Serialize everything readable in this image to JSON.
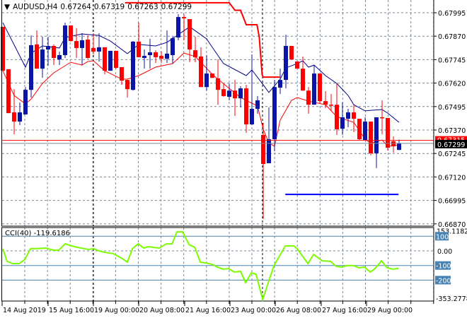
{
  "header": {
    "menu_icon": "triangle-down-icon",
    "symbol": "AUDUSD,H4",
    "open": "0.67264",
    "high": "0.67319",
    "low": "0.67263",
    "close": "0.67299"
  },
  "colors": {
    "bull": "#0a14a8",
    "bear": "#ff0000",
    "ma_fast": "#ff0000",
    "ma_slow": "#00008b",
    "step_line": "#ff0000",
    "support_line": "#0000ff",
    "cci": "#7cfc00",
    "cci_level": "#4682b4",
    "grid": "#778899"
  },
  "price_axis": {
    "labels": [
      "0.67995",
      "0.67870",
      "0.67745",
      "0.67620",
      "0.67495",
      "0.67370",
      "0.67245",
      "0.67120",
      "0.66995",
      "0.66870"
    ],
    "ask_label": "0.67315",
    "bid_label": "0.67299"
  },
  "time_axis": {
    "labels": [
      "14 Aug 2019",
      "15 Aug 16:00",
      "19 Aug 00:00",
      "20 Aug 08:00",
      "21 Aug 16:00",
      "23 Aug 00:00",
      "26 Aug 08:00",
      "27 Aug 16:00",
      "29 Aug 00:00"
    ]
  },
  "cci": {
    "title": "CCI(40) -119.6186",
    "axis_labels": {
      "max": "153.1182",
      "l100": "100",
      "l0": "0.00",
      "lm100": "-100",
      "lm200": "-200",
      "min": "-353.2778"
    }
  },
  "chart_data": {
    "type": "candlestick",
    "symbol": "AUDUSD",
    "timeframe": "H4",
    "ylim": [
      0.6687,
      0.68048
    ],
    "candles": [
      [
        0.6792,
        0.6792,
        0.67686,
        0.67686
      ],
      [
        0.67694,
        0.67694,
        0.6746,
        0.6746
      ],
      [
        0.67464,
        0.67588,
        0.67347,
        0.67415
      ],
      [
        0.67415,
        0.67517,
        0.67396,
        0.67464
      ],
      [
        0.67453,
        0.67599,
        0.67453,
        0.67584
      ],
      [
        0.67584,
        0.67874,
        0.67543,
        0.67822
      ],
      [
        0.67826,
        0.67901,
        0.67697,
        0.67697
      ],
      [
        0.67697,
        0.67867,
        0.67648,
        0.67799
      ],
      [
        0.67799,
        0.67867,
        0.67712,
        0.67818
      ],
      [
        0.67818,
        0.67826,
        0.67716,
        0.67754
      ],
      [
        0.67746,
        0.67788,
        0.67716,
        0.67769
      ],
      [
        0.67769,
        0.67942,
        0.67754,
        0.67927
      ],
      [
        0.67927,
        0.67927,
        0.67841,
        0.67844
      ],
      [
        0.67844,
        0.67912,
        0.67754,
        0.67807
      ],
      [
        0.67807,
        0.67886,
        0.67716,
        0.67848
      ],
      [
        0.67852,
        0.67874,
        0.6775,
        0.67754
      ],
      [
        0.67807,
        0.67886,
        0.67773,
        0.67788
      ],
      [
        0.67788,
        0.67886,
        0.67735,
        0.67811
      ],
      [
        0.67811,
        0.67811,
        0.67667,
        0.67686
      ],
      [
        0.67686,
        0.67792,
        0.67686,
        0.67792
      ],
      [
        0.67792,
        0.67792,
        0.67697,
        0.67701
      ],
      [
        0.67705,
        0.67705,
        0.67611,
        0.67633
      ],
      [
        0.67637,
        0.67637,
        0.67543,
        0.67588
      ],
      [
        0.67584,
        0.67844,
        0.6758,
        0.67841
      ],
      [
        0.67841,
        0.67942,
        0.67758,
        0.67758
      ],
      [
        0.67754,
        0.67799,
        0.67697,
        0.67765
      ],
      [
        0.67769,
        0.67856,
        0.67697,
        0.67784
      ],
      [
        0.67784,
        0.67795,
        0.67727,
        0.67758
      ],
      [
        0.67765,
        0.67788,
        0.67727,
        0.6775
      ],
      [
        0.6775,
        0.67901,
        0.67727,
        0.67777
      ],
      [
        0.67769,
        0.67867,
        0.67724,
        0.67859
      ],
      [
        0.67863,
        0.67988,
        0.67848,
        0.67972
      ],
      [
        0.67972,
        0.67988,
        0.67848,
        0.67965
      ],
      [
        0.67961,
        0.67961,
        0.67731,
        0.67799
      ],
      [
        0.67795,
        0.67867,
        0.67731,
        0.67758
      ],
      [
        0.67762,
        0.67811,
        0.67599,
        0.67599
      ],
      [
        0.67599,
        0.67769,
        0.6758,
        0.67671
      ],
      [
        0.67671,
        0.67671,
        0.67648,
        0.67648
      ],
      [
        0.67645,
        0.67746,
        0.67505,
        0.67584
      ],
      [
        0.67588,
        0.67618,
        0.67547,
        0.67551
      ],
      [
        0.67547,
        0.67618,
        0.67528,
        0.6758
      ],
      [
        0.6758,
        0.67637,
        0.67445,
        0.67539
      ],
      [
        0.67539,
        0.67603,
        0.6749,
        0.67592
      ],
      [
        0.67592,
        0.67611,
        0.67355,
        0.674
      ],
      [
        0.674,
        0.67773,
        0.67396,
        0.67483
      ],
      [
        0.67483,
        0.67551,
        0.67457,
        0.67528
      ],
      [
        0.67344,
        0.67408,
        0.66896,
        0.67189
      ],
      [
        0.67193,
        0.6749,
        0.67193,
        0.67321
      ],
      [
        0.67321,
        0.67637,
        0.67257,
        0.67599
      ],
      [
        0.67596,
        0.67697,
        0.67562,
        0.67637
      ],
      [
        0.67637,
        0.67878,
        0.67592,
        0.67818
      ],
      [
        0.67818,
        0.67818,
        0.67746,
        0.67746
      ],
      [
        0.67735,
        0.67735,
        0.67697,
        0.67697
      ],
      [
        0.67697,
        0.67762,
        0.6758,
        0.6758
      ],
      [
        0.6758,
        0.67599,
        0.67457,
        0.67505
      ],
      [
        0.67505,
        0.67716,
        0.67505,
        0.67671
      ],
      [
        0.67671,
        0.67671,
        0.67509,
        0.67524
      ],
      [
        0.67524,
        0.67577,
        0.67487,
        0.67505
      ],
      [
        0.67505,
        0.67562,
        0.67472,
        0.67502
      ],
      [
        0.67505,
        0.67618,
        0.67344,
        0.67374
      ],
      [
        0.67377,
        0.67517,
        0.67344,
        0.67438
      ],
      [
        0.6743,
        0.67483,
        0.67385,
        0.67464
      ],
      [
        0.67464,
        0.67502,
        0.67359,
        0.6743
      ],
      [
        0.6743,
        0.6743,
        0.67317,
        0.67321
      ],
      [
        0.67317,
        0.67438,
        0.67317,
        0.67415
      ],
      [
        0.67415,
        0.67415,
        0.67235,
        0.67246
      ],
      [
        0.67246,
        0.67438,
        0.67167,
        0.67438
      ],
      [
        0.67438,
        0.67528,
        0.67347,
        0.67434
      ],
      [
        0.67434,
        0.67434,
        0.67261,
        0.67276
      ],
      [
        0.6731,
        0.67336,
        0.6725,
        0.67283
      ],
      [
        0.67264,
        0.67319,
        0.67263,
        0.67299
      ]
    ],
    "ma_slow": [
      [
        0,
        0.67942
      ],
      [
        4,
        0.67705
      ],
      [
        5,
        0.6778
      ],
      [
        7,
        0.67818
      ],
      [
        10,
        0.67807
      ],
      [
        11,
        0.67863
      ],
      [
        14,
        0.67882
      ],
      [
        17,
        0.67874
      ],
      [
        19,
        0.67844
      ],
      [
        22,
        0.67777
      ],
      [
        24,
        0.67826
      ],
      [
        27,
        0.67818
      ],
      [
        29,
        0.67837
      ],
      [
        33,
        0.6792
      ],
      [
        36,
        0.67856
      ],
      [
        37,
        0.67811
      ],
      [
        39,
        0.67724
      ],
      [
        43,
        0.6766
      ],
      [
        44,
        0.6769
      ],
      [
        46,
        0.67611
      ],
      [
        47,
        0.6757
      ],
      [
        49,
        0.67641
      ],
      [
        50,
        0.67701
      ],
      [
        52,
        0.67724
      ],
      [
        53,
        0.67739
      ],
      [
        54,
        0.67705
      ],
      [
        55,
        0.67716
      ],
      [
        57,
        0.6766
      ],
      [
        59,
        0.67618
      ],
      [
        61,
        0.67554
      ],
      [
        62,
        0.67505
      ],
      [
        64,
        0.67472
      ],
      [
        65,
        0.67475
      ],
      [
        67,
        0.67479
      ],
      [
        68,
        0.6746
      ],
      [
        70,
        0.67411
      ]
    ],
    "ma_fast": [
      [
        0,
        0.67686
      ],
      [
        2,
        0.67554
      ],
      [
        4,
        0.67509
      ],
      [
        5,
        0.67535
      ],
      [
        7,
        0.67618
      ],
      [
        9,
        0.67675
      ],
      [
        12,
        0.67731
      ],
      [
        14,
        0.67716
      ],
      [
        15,
        0.67735
      ],
      [
        16,
        0.67739
      ],
      [
        18,
        0.67686
      ],
      [
        21,
        0.67641
      ],
      [
        22,
        0.67641
      ],
      [
        24,
        0.6766
      ],
      [
        27,
        0.67705
      ],
      [
        30,
        0.67724
      ],
      [
        32,
        0.6778
      ],
      [
        34,
        0.67762
      ],
      [
        37,
        0.67667
      ],
      [
        38,
        0.67641
      ],
      [
        42,
        0.67543
      ],
      [
        45,
        0.67498
      ],
      [
        46,
        0.67374
      ],
      [
        47,
        0.67302
      ],
      [
        48,
        0.67283
      ],
      [
        49,
        0.67423
      ],
      [
        51,
        0.67528
      ],
      [
        52,
        0.67543
      ],
      [
        54,
        0.67524
      ],
      [
        57,
        0.67505
      ],
      [
        59,
        0.67441
      ],
      [
        62,
        0.67411
      ],
      [
        64,
        0.67321
      ],
      [
        65,
        0.67299
      ],
      [
        67,
        0.67317
      ],
      [
        68,
        0.67283
      ],
      [
        70,
        0.67291
      ]
    ],
    "step_line": [
      [
        21.6,
        0.68048
      ],
      [
        40,
        0.68048
      ],
      [
        41,
        0.68008
      ],
      [
        42,
        0.68008
      ],
      [
        43,
        0.67931
      ],
      [
        44.9,
        0.67931
      ],
      [
        45.3,
        0.67865
      ],
      [
        45.8,
        0.67667
      ],
      [
        46,
        0.67652
      ],
      [
        48.9,
        0.67652
      ]
    ],
    "support_line": {
      "price": 0.67027,
      "from": 49.9,
      "to": 69.9
    },
    "ask_price": 0.67315,
    "bid_price": 0.67299,
    "cci_series": [
      [
        0,
        15
      ],
      [
        0.75,
        -72
      ],
      [
        1.75,
        -87
      ],
      [
        2.9,
        -87
      ],
      [
        3.9,
        -58
      ],
      [
        4.9,
        15
      ],
      [
        5.75,
        15
      ],
      [
        7.6,
        19
      ],
      [
        8.9,
        5
      ],
      [
        9.9,
        5
      ],
      [
        11,
        48
      ],
      [
        12.6,
        29
      ],
      [
        13.9,
        19
      ],
      [
        15.1,
        10
      ],
      [
        16.1,
        15
      ],
      [
        17,
        0
      ],
      [
        18,
        -10
      ],
      [
        19.5,
        -19
      ],
      [
        21.1,
        -53
      ],
      [
        22,
        -77
      ],
      [
        22.9,
        15
      ],
      [
        23.9,
        48
      ],
      [
        24.9,
        19
      ],
      [
        25.75,
        29
      ],
      [
        27.6,
        19
      ],
      [
        28.9,
        48
      ],
      [
        29.9,
        48
      ],
      [
        30.75,
        130
      ],
      [
        31.75,
        130
      ],
      [
        32.9,
        43
      ],
      [
        33.9,
        24
      ],
      [
        34.9,
        -77
      ],
      [
        35.75,
        -82
      ],
      [
        37,
        -92
      ],
      [
        37.9,
        -111
      ],
      [
        38.9,
        -125
      ],
      [
        39.9,
        -121
      ],
      [
        40.9,
        -145
      ],
      [
        42,
        -140
      ],
      [
        42.9,
        -217
      ],
      [
        43.9,
        -150
      ],
      [
        44.75,
        -160
      ],
      [
        45.9,
        -333
      ],
      [
        47.9,
        -101
      ],
      [
        49.9,
        34
      ],
      [
        51.4,
        34
      ],
      [
        52,
        15
      ],
      [
        53.9,
        -87
      ],
      [
        54.9,
        -24
      ],
      [
        56.4,
        -68
      ],
      [
        57.9,
        -72
      ],
      [
        58.9,
        -106
      ],
      [
        59.9,
        -111
      ],
      [
        60.75,
        -101
      ],
      [
        62,
        -101
      ],
      [
        62.9,
        -116
      ],
      [
        63.9,
        -111
      ],
      [
        64.9,
        -145
      ],
      [
        65.75,
        -121
      ],
      [
        66.9,
        -68
      ],
      [
        67.9,
        -116
      ],
      [
        68.9,
        -125
      ],
      [
        69.9,
        -120
      ]
    ],
    "cci_levels": [
      100,
      0,
      -100,
      -200
    ],
    "cci_range": [
      -353.2778,
      153.1182
    ]
  }
}
